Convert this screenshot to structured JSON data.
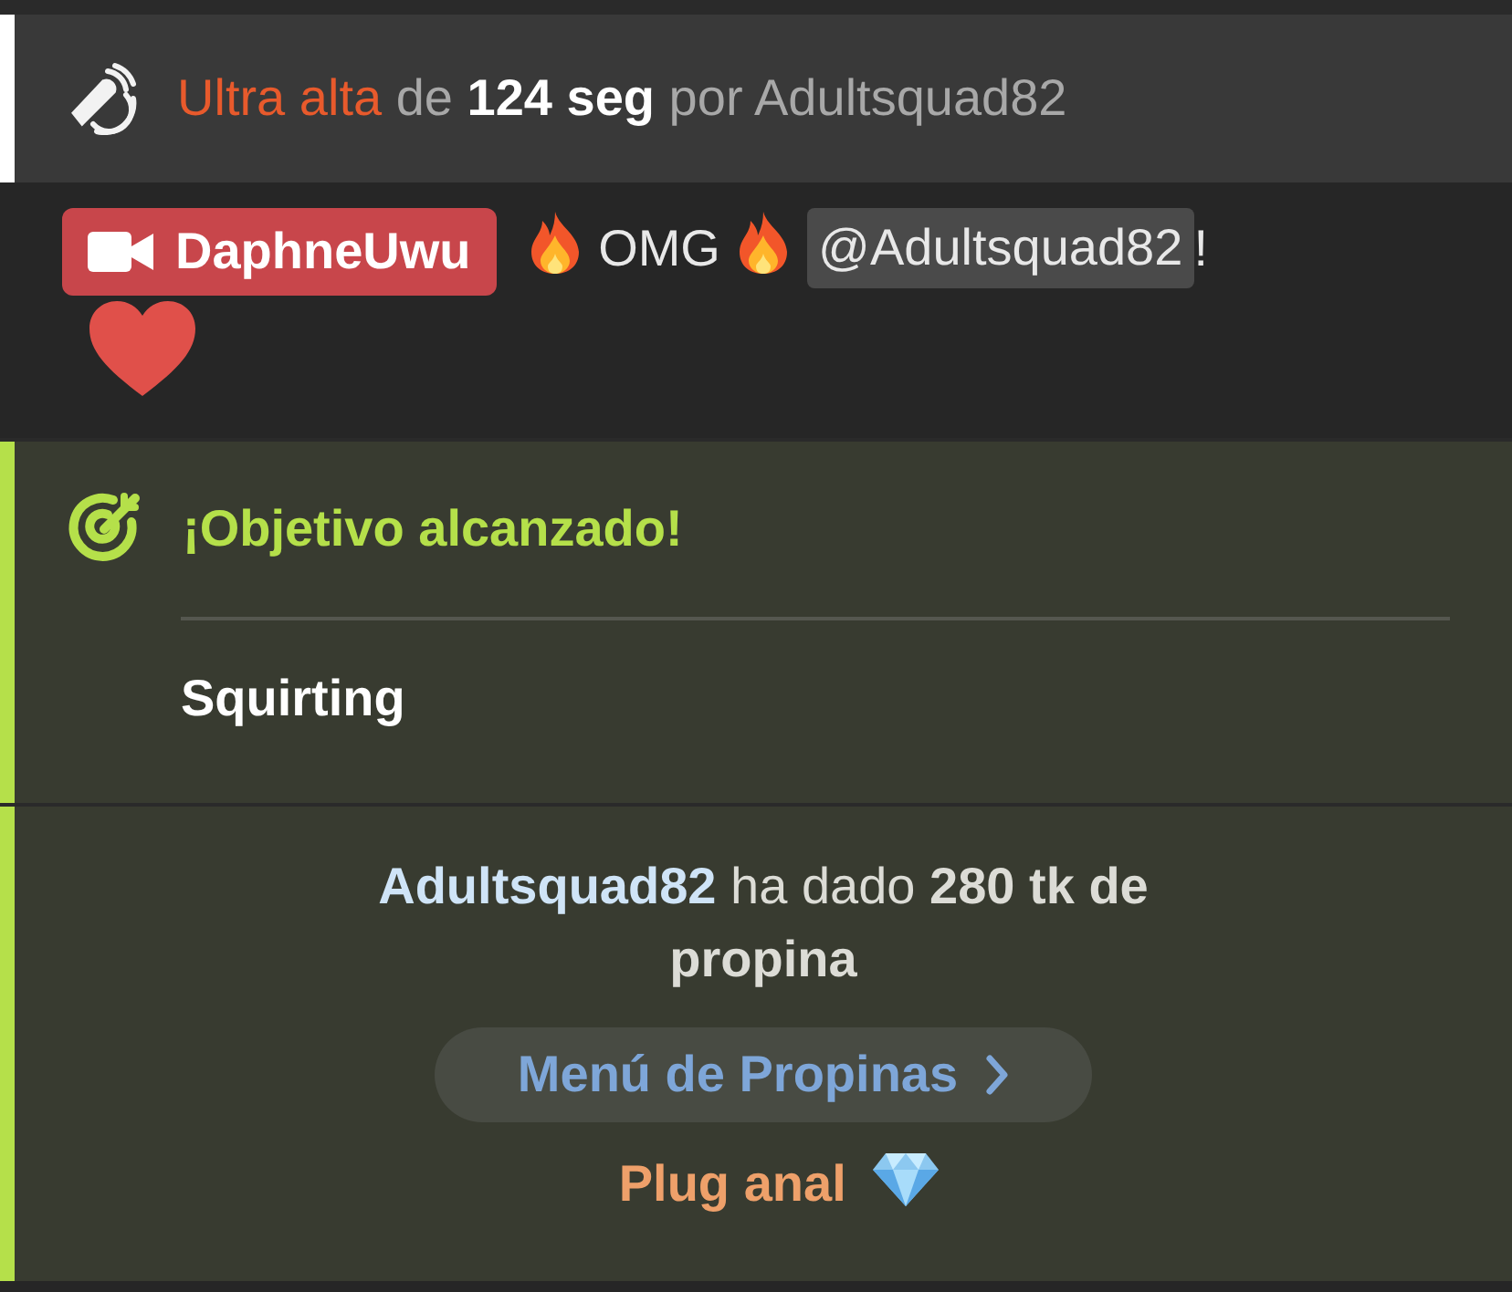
{
  "toy_event": {
    "segments": [
      {
        "kind": "level",
        "text": "Ultra alta"
      },
      {
        "kind": "muted",
        "text": "de"
      },
      {
        "kind": "strong",
        "text": "124 seg"
      },
      {
        "kind": "muted",
        "text": "por Adultsquad82"
      }
    ]
  },
  "chat_message": {
    "sender": "DaphneUwu",
    "parts": [
      {
        "kind": "fire"
      },
      {
        "kind": "text",
        "text": "OMG"
      },
      {
        "kind": "fire"
      },
      {
        "kind": "mention",
        "text": "@Adultsquad82"
      },
      {
        "kind": "text",
        "text": "!"
      },
      {
        "kind": "heart"
      }
    ]
  },
  "goal": {
    "title": "¡Objetivo alcanzado!",
    "name": "Squirting"
  },
  "tip": {
    "user": "Adultsquad82",
    "text": "ha dado **280 tk de propina**",
    "menu_button": "Menú de Propinas",
    "item": "Plug anal"
  }
}
